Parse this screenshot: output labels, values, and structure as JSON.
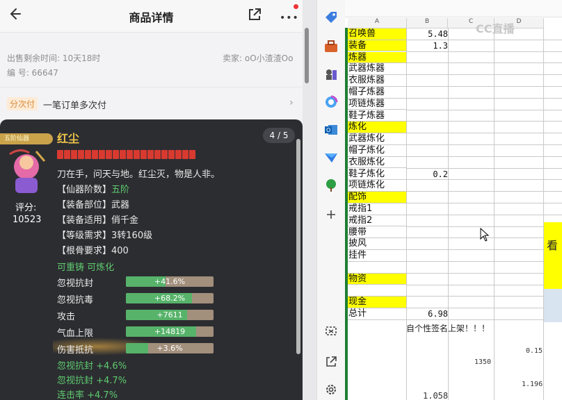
{
  "header": {
    "title": "商品详情",
    "more": "•••"
  },
  "listing": {
    "time_left": "出售剩余时间: 10天18时",
    "seller": "卖家: oO小渣渣Oo",
    "number": "编 号: 66647",
    "pay_tag": "分次付",
    "pay_text": "一笔订单多次付",
    "chevron": "›"
  },
  "item": {
    "pager": "4 / 5",
    "badge": "五阶仙器",
    "name": "红尘",
    "star_count": 20,
    "score_label": "评分:",
    "score": "10523",
    "description": "刀在手，问天与地。红尘灭，物是人非。",
    "attrs": [
      {
        "label": "【仙器阶数】",
        "value": "五阶",
        "green": true
      },
      {
        "label": "【装备部位】",
        "value": "武器",
        "green": false
      },
      {
        "label": "【装备适用】",
        "value": "俏千金",
        "green": false
      },
      {
        "label": "【等级需求】",
        "value": "3转160级",
        "green": false
      },
      {
        "label": "【根骨要求】",
        "value": "400",
        "green": false
      }
    ],
    "tags": "可重铸 可炼化",
    "stats": [
      {
        "name": "忽视抗封",
        "value": "+41.6%",
        "fill": 0.45
      },
      {
        "name": "忽视抗毒",
        "value": "+68.2%",
        "fill": 0.75
      },
      {
        "name": "攻击",
        "value": "+7611",
        "fill": 0.7
      },
      {
        "name": "气血上限",
        "value": "+14819",
        "fill": 0.8
      },
      {
        "name": "伤害抵抗",
        "value": "+3.6%",
        "fill": 0.25
      }
    ],
    "extra_stats": [
      "忽视抗封 +4.6%",
      "忽视抗封 +4.7%",
      "连击率 +4.7%"
    ]
  },
  "sheet": {
    "columns": [
      "A",
      "B",
      "C",
      "D"
    ],
    "watermark": "CC直播",
    "rows": [
      {
        "a": "召唤兽",
        "b": "5.48",
        "yellow": true
      },
      {
        "a": "装备",
        "b": "1.3",
        "yellow": true
      },
      {
        "a": "炼器",
        "b": "",
        "yellow": true
      },
      {
        "a": "武器炼器",
        "b": "",
        "yellow": false
      },
      {
        "a": "衣服炼器",
        "b": "",
        "yellow": false
      },
      {
        "a": "帽子炼器",
        "b": "",
        "yellow": false
      },
      {
        "a": "项链炼器",
        "b": "",
        "yellow": false
      },
      {
        "a": "鞋子炼器",
        "b": "",
        "yellow": false
      },
      {
        "a": "炼化",
        "b": "",
        "yellow": true
      },
      {
        "a": "武器炼化",
        "b": "",
        "yellow": false
      },
      {
        "a": "帽子炼化",
        "b": "",
        "yellow": false
      },
      {
        "a": "衣服炼化",
        "b": "",
        "yellow": false
      },
      {
        "a": "鞋子炼化",
        "b": "0.2",
        "yellow": false
      },
      {
        "a": "项链炼化",
        "b": "",
        "yellow": false
      },
      {
        "a": "配饰",
        "b": "",
        "yellow": true
      },
      {
        "a": "戒指1",
        "b": "",
        "yellow": false
      },
      {
        "a": "戒指2",
        "b": "",
        "yellow": false
      },
      {
        "a": "腰带",
        "b": "",
        "yellow": false
      },
      {
        "a": "披风",
        "b": "",
        "yellow": false
      },
      {
        "a": "挂件",
        "b": "",
        "yellow": false
      },
      {
        "a": "",
        "b": "",
        "yellow": false
      },
      {
        "a": "物资",
        "b": "",
        "yellow": true
      },
      {
        "a": "",
        "b": "",
        "yellow": false
      },
      {
        "a": "现金",
        "b": "",
        "yellow": true
      },
      {
        "a": "总计",
        "b": "6.98",
        "yellow": false
      }
    ],
    "side_char": "看",
    "banner": "自个性签名上架！！！",
    "n1": "0.15",
    "n2": "1350",
    "n3": "1.196",
    "n4": "1.058"
  },
  "colors": {
    "accent_gold": "#f0c64a",
    "green": "#5ecb6f",
    "yellow_cell": "#ffff00"
  }
}
